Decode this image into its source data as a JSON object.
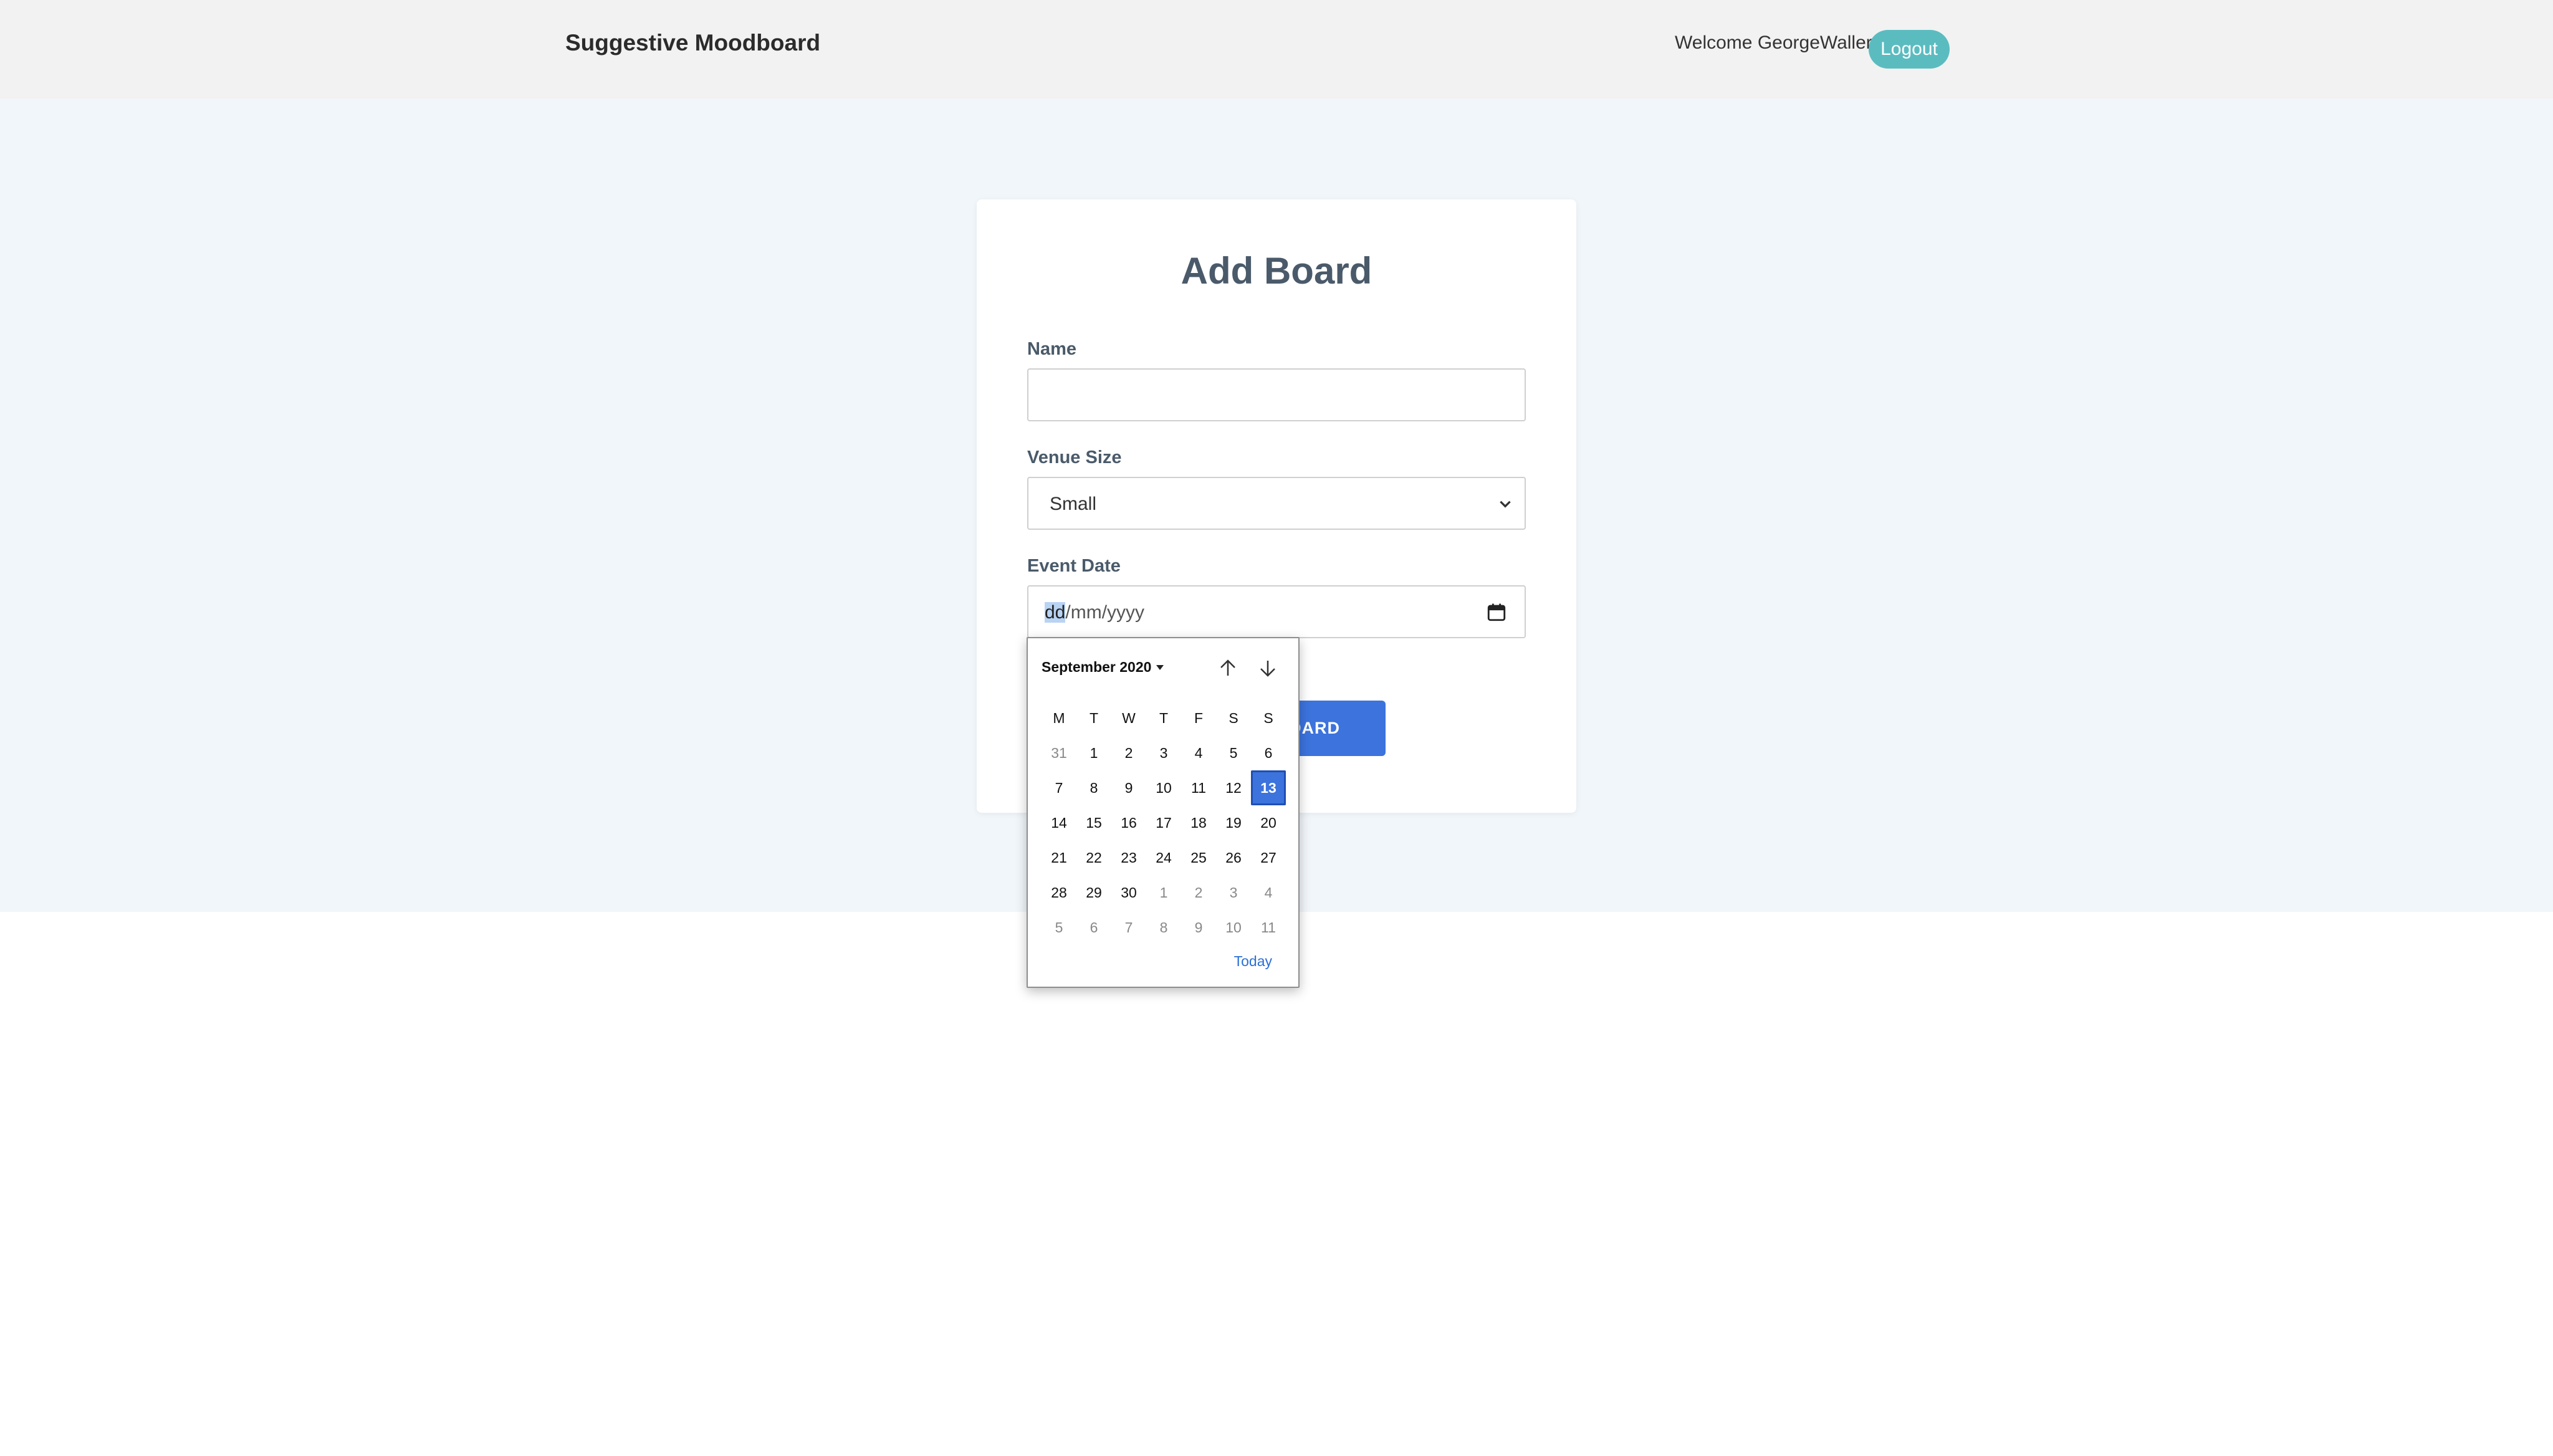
{
  "navbar": {
    "brand": "Suggestive Moodboard",
    "welcome": "Welcome GeorgeWaller",
    "logout_label": "Logout"
  },
  "form": {
    "title": "Add Board",
    "name_label": "Name",
    "name_value": "",
    "venue_label": "Venue Size",
    "venue_value": "Small",
    "date_label": "Event Date",
    "date_placeholder_day": "dd",
    "date_placeholder_rest": "/mm/yyyy",
    "submit_label_visible": "OARD"
  },
  "datepicker": {
    "month_label": "September 2020",
    "weekdays": [
      "M",
      "T",
      "W",
      "T",
      "F",
      "S",
      "S"
    ],
    "weeks": [
      [
        {
          "d": "31",
          "m": true
        },
        {
          "d": "1"
        },
        {
          "d": "2"
        },
        {
          "d": "3"
        },
        {
          "d": "4"
        },
        {
          "d": "5"
        },
        {
          "d": "6"
        }
      ],
      [
        {
          "d": "7"
        },
        {
          "d": "8"
        },
        {
          "d": "9"
        },
        {
          "d": "10"
        },
        {
          "d": "11"
        },
        {
          "d": "12"
        },
        {
          "d": "13",
          "sel": true
        }
      ],
      [
        {
          "d": "14"
        },
        {
          "d": "15"
        },
        {
          "d": "16"
        },
        {
          "d": "17"
        },
        {
          "d": "18"
        },
        {
          "d": "19"
        },
        {
          "d": "20"
        }
      ],
      [
        {
          "d": "21"
        },
        {
          "d": "22"
        },
        {
          "d": "23"
        },
        {
          "d": "24"
        },
        {
          "d": "25"
        },
        {
          "d": "26"
        },
        {
          "d": "27"
        }
      ],
      [
        {
          "d": "28"
        },
        {
          "d": "29"
        },
        {
          "d": "30"
        },
        {
          "d": "1",
          "m": true
        },
        {
          "d": "2",
          "m": true
        },
        {
          "d": "3",
          "m": true
        },
        {
          "d": "4",
          "m": true
        }
      ],
      [
        {
          "d": "5",
          "m": true
        },
        {
          "d": "6",
          "m": true
        },
        {
          "d": "7",
          "m": true
        },
        {
          "d": "8",
          "m": true
        },
        {
          "d": "9",
          "m": true
        },
        {
          "d": "10",
          "m": true
        },
        {
          "d": "11",
          "m": true
        }
      ]
    ],
    "today_label": "Today"
  },
  "colors": {
    "accent_blue": "#3c73dd",
    "logout_teal": "#5bbcc0",
    "page_bg": "#f1f6fa"
  }
}
